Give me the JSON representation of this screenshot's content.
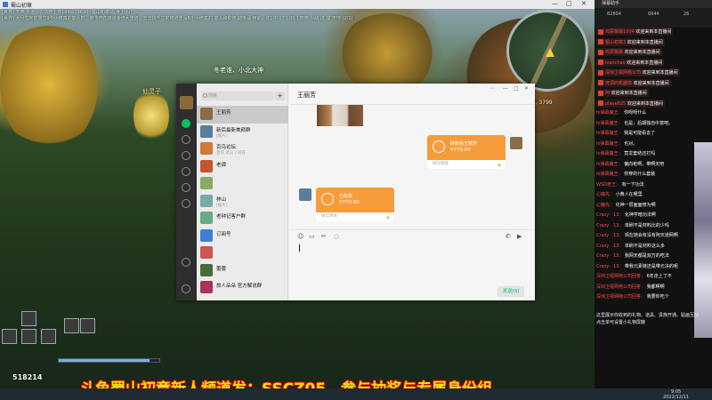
{
  "game": {
    "window_title": "蜀山初章",
    "chat_lines": [
      "[世界] 无神 大道：古前修士地1d4d/29690 (蜀山初章)在身上人(国)。",
      "[世界] 大月生地前重生9个小修真的能人时，俯卡开在双道金修大重道，去去找千古前修道重没8个小修真的 能人和你修 动传请 用此，成[ 中 ] ? [ 09 ] 双修 小战 进 成 天地 (2/1)"
    ],
    "speech_bubble": "冬老谁、小北大神",
    "npc_label": "仙灵子",
    "coords": "-477, 3799",
    "level": "518214",
    "hp_fill": 0.9,
    "banner": "斗鱼蜀山初章新人频道发：SSCZ05，参与抽奖与专属身份组"
  },
  "taskbar": {
    "time": "9:05",
    "date": "2022/12/11"
  },
  "wechat": {
    "search_placeholder": "搜索",
    "plus": "+",
    "chat_name": "王丽芳",
    "window_buttons": [
      "⋯",
      "—",
      "□",
      "✕"
    ],
    "conversations": [
      {
        "name": "王丽芳",
        "msg": "",
        "time": "",
        "color": "#8b6e46",
        "selected": true
      },
      {
        "name": "新后最新美颜群",
        "msg": "[图片]",
        "time": "",
        "color": "#5a7d9a"
      },
      {
        "name": "百鸟论坛",
        "msg": "百货 老公 / 问答",
        "time": "",
        "color": "#d07a3a"
      },
      {
        "name": "老谭",
        "msg": "",
        "time": "",
        "color": "#c5552f"
      },
      {
        "name": "",
        "msg": "",
        "time": "",
        "color": "#8a6"
      },
      {
        "name": "林山",
        "msg": "[图片]",
        "time": "",
        "color": "#7aa"
      },
      {
        "name": "老钟记客户群",
        "msg": "",
        "time": "",
        "color": "#6a8"
      },
      {
        "name": "订阅号",
        "msg": "",
        "time": "",
        "color": "#3d7fd6"
      },
      {
        "name": "",
        "msg": "",
        "time": "",
        "color": "#c55"
      },
      {
        "name": "蕾蕾",
        "msg": "",
        "time": "",
        "color": "#4a6a3a"
      },
      {
        "name": "旅人朵朵 官方解说群",
        "msg": "",
        "time": "",
        "color": "#a35"
      }
    ],
    "transfer_sent": {
      "label": "转账给王丽芳",
      "amount": "¥770.00",
      "footer": "微信转账"
    },
    "transfer_recv": {
      "label": "已收款",
      "amount": "¥770.00",
      "footer": "微信转账"
    },
    "timestamp": "",
    "tool_icons": [
      "☺",
      "▭",
      "✂",
      "◌"
    ],
    "call_icons": [
      "✆",
      "▶"
    ],
    "send_label": "发送(S)"
  },
  "panel": {
    "title": "弹幕助手",
    "stats": [
      "82804",
      "6844",
      "26"
    ],
    "messages": [
      {
        "user": "鸡屎飘飘1004",
        "text": "欢迎来到本直播间",
        "boxed": true
      },
      {
        "user": "蜀山初章3",
        "text": "欢迎来到本直播间",
        "boxed": true
      },
      {
        "user": "鸡屎飘飘",
        "text": "欢迎来到本直播间",
        "boxed": true
      },
      {
        "user": "ivanchao",
        "text": "欢迎来到本直播间",
        "boxed": true
      },
      {
        "user": "深圳卫视网络公司",
        "text": "欢迎来到本直播间",
        "boxed": true
      },
      {
        "user": "死调的机器狗",
        "text": "欢迎来到本直播间",
        "boxed": true
      },
      {
        "user": "阿",
        "text": "欢迎来到本直播间",
        "boxed": true
      },
      {
        "user": "plave025",
        "text": "欢迎来到本直播间",
        "boxed": true
      },
      {
        "user": "hi弹幕魔王：",
        "text": "你呀呀什么"
      },
      {
        "user": "hi弹幕魔王：",
        "text": "也是，后期独自中意吧。"
      },
      {
        "user": "hi弹幕魔王：",
        "text": "我是可能看去了"
      },
      {
        "user": "hi弹幕魔王：",
        "text": "也对。"
      },
      {
        "user": "hi弹幕魔王：",
        "text": "竟龙套结还打吗"
      },
      {
        "user": "hi弹幕魔王：",
        "text": "偏向枪啊，带啊天吧"
      },
      {
        "user": "hi弹幕魔王：",
        "text": "你穿的什么套装"
      },
      {
        "user": "WSD老王：",
        "text": "有一下功法"
      },
      {
        "user": "心魔先：",
        "text": "小黄人在哪里"
      },
      {
        "user": "心魔先：",
        "text": "化神一层面面修为啊"
      },
      {
        "user": "Crazy · 13：",
        "text": "化神学暗功法啊"
      },
      {
        "user": "Crazy · 13：",
        "text": "单刷不是材料比的少吗"
      },
      {
        "user": "Crazy · 13：",
        "text": "现在她会有没有阿天道网啊"
      },
      {
        "user": "Crazy · 13：",
        "text": "单刷不是材料这么多"
      },
      {
        "user": "Crazy · 13：",
        "text": "我网天都是双万的吃法"
      },
      {
        "user": "Crazy · 13：",
        "text": "带我元素链还是带元决的呢"
      },
      {
        "user": "深圳卫视网络公司回答：",
        "text": "6年走上了不"
      },
      {
        "user": "深圳卫视网络公司回答：",
        "text": "我都啊啊"
      },
      {
        "user": "深圳卫视网络公司回答：",
        "text": "我要你吃个"
      }
    ],
    "footer_lines": [
      "这里展示你收到的礼物、道具、贵族开通、贴画互动",
      "点击单可设置小礼物屏蔽"
    ]
  }
}
